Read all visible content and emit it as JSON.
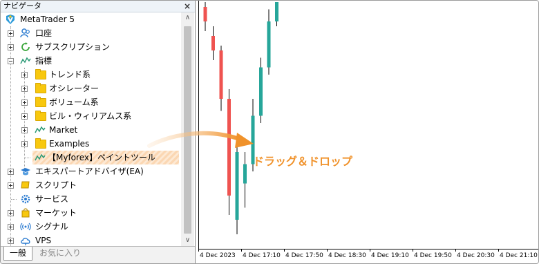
{
  "navigator": {
    "title": "ナビゲータ",
    "close": "×",
    "root": "MetaTrader 5",
    "items": [
      {
        "label": "口座"
      },
      {
        "label": "サブスクリプション"
      },
      {
        "label": "指標"
      },
      {
        "label": "トレンド系"
      },
      {
        "label": "オシレーター"
      },
      {
        "label": "ボリューム系"
      },
      {
        "label": "ビル・ウィリアムス系"
      },
      {
        "label": "Market"
      },
      {
        "label": "Examples"
      },
      {
        "label": "【Myforex】ペイントツール"
      },
      {
        "label": "エキスパートアドバイザ(EA)"
      },
      {
        "label": "スクリプト"
      },
      {
        "label": "サービス"
      },
      {
        "label": "マーケット"
      },
      {
        "label": "シグナル"
      },
      {
        "label": "VPS"
      }
    ],
    "tabs": [
      {
        "label": "一般"
      },
      {
        "label": "お気に入り"
      }
    ],
    "scroll_up": "∧",
    "scroll_down": "∨"
  },
  "annotation": {
    "text": "ドラッグ＆ドロップ",
    "color": "#f0922b"
  },
  "chart": {
    "x_labels": [
      "4 Dec 2023",
      "4 Dec 17:10",
      "4 Dec 17:50",
      "4 Dec 18:30",
      "4 Dec 19:10",
      "4 Dec 19:50",
      "4 Dec 20:30",
      "4 Dec 21:10"
    ],
    "colors": {
      "up": "#26a69a",
      "down": "#ef5350"
    }
  },
  "chart_data": {
    "type": "candlestick",
    "x": [
      "4 Dec 2023",
      "4 Dec 17:10",
      "4 Dec 17:50",
      "4 Dec 18:30",
      "4 Dec 19:10",
      "4 Dec 19:50",
      "4 Dec 20:30",
      "4 Dec 21:10"
    ],
    "candles": [
      {
        "dir": "down",
        "open": 0.98,
        "close": 0.92,
        "high": 1.0,
        "low": 0.88
      },
      {
        "dir": "down",
        "open": 0.86,
        "close": 0.8,
        "high": 0.9,
        "low": 0.76
      },
      {
        "dir": "down",
        "open": 0.8,
        "close": 0.6,
        "high": 0.82,
        "low": 0.55
      },
      {
        "dir": "down",
        "open": 0.6,
        "close": 0.2,
        "high": 0.64,
        "low": 0.12
      },
      {
        "dir": "up",
        "open": 0.1,
        "close": 0.38,
        "high": 0.44,
        "low": 0.04
      },
      {
        "dir": "up",
        "open": 0.25,
        "close": 0.33,
        "high": 0.38,
        "low": 0.15
      },
      {
        "dir": "up",
        "open": 0.33,
        "close": 0.53,
        "high": 0.6,
        "low": 0.3
      },
      {
        "dir": "up",
        "open": 0.53,
        "close": 0.73,
        "high": 0.77,
        "low": 0.5
      },
      {
        "dir": "up",
        "open": 0.73,
        "close": 0.92,
        "high": 0.97,
        "low": 0.7
      },
      {
        "dir": "up",
        "open": 0.92,
        "close": 1.0,
        "high": 1.0,
        "low": 0.9
      }
    ]
  }
}
